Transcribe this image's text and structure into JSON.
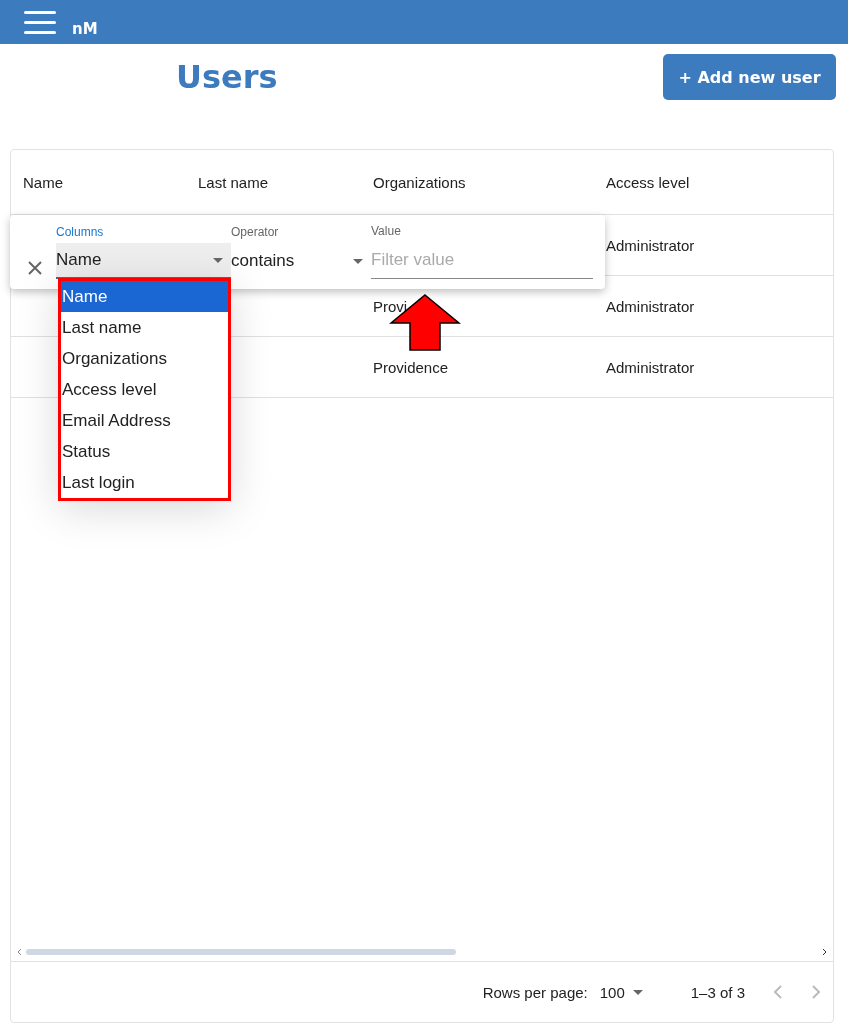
{
  "app_bar": {
    "logo": "nM"
  },
  "page": {
    "title": "Users",
    "add_button": "+ Add new user"
  },
  "table": {
    "columns": [
      "Name",
      "Last name",
      "Organizations",
      "Access level"
    ],
    "rows": [
      {
        "access_level": "Administrator"
      },
      {
        "organization": "Provi",
        "access_level": "Administrator"
      },
      {
        "organization": "Providence",
        "access_level": "Administrator"
      }
    ]
  },
  "filter_panel": {
    "columns_label": "Columns",
    "columns_value": "Name",
    "operator_label": "Operator",
    "operator_value": "contains",
    "value_label": "Value",
    "value_placeholder": "Filter value"
  },
  "column_menu": [
    {
      "label": "Name",
      "selected": true
    },
    {
      "label": "Last name",
      "selected": false
    },
    {
      "label": "Organizations",
      "selected": false
    },
    {
      "label": "Access level",
      "selected": false
    },
    {
      "label": "Email Address",
      "selected": false
    },
    {
      "label": "Status",
      "selected": false
    },
    {
      "label": "Last login",
      "selected": false
    }
  ],
  "footer": {
    "rows_per_page_label": "Rows per page:",
    "rows_per_page": "100",
    "range": "1–3 of 3"
  }
}
